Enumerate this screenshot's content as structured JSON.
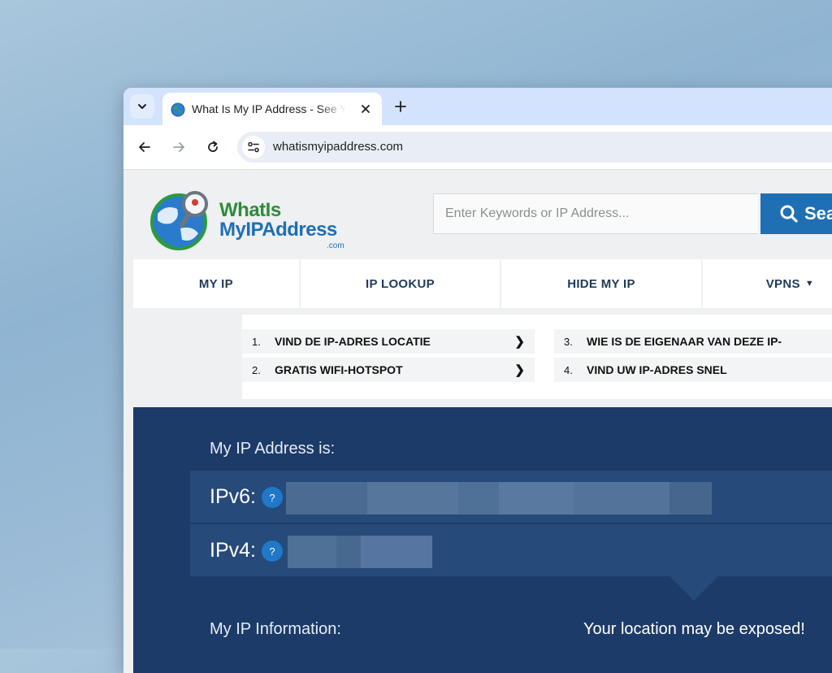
{
  "browser": {
    "tab": {
      "title": "What Is My IP Address - See Your Public IP",
      "favicon": "globe-icon"
    },
    "url": "whatismyipaddress.com"
  },
  "site": {
    "logo": {
      "line1": "WhatIs",
      "line2": "MyIPAddress",
      "line3": ".com"
    },
    "search": {
      "placeholder": "Enter Keywords or IP Address...",
      "button_label": "Sea"
    },
    "nav": [
      {
        "label": "MY IP"
      },
      {
        "label": "IP LOOKUP"
      },
      {
        "label": "HIDE MY IP"
      },
      {
        "label": "VPNS",
        "caret": "▼"
      }
    ],
    "ads": [
      {
        "num": "1.",
        "label": "VIND DE IP-ADRES LOCATIE",
        "chevron": "❯"
      },
      {
        "num": "2.",
        "label": "GRATIS WIFI-HOTSPOT",
        "chevron": "❯"
      },
      {
        "num": "3.",
        "label": "WIE IS DE EIGENAAR VAN DEZE IP-",
        "chevron": "❯"
      },
      {
        "num": "4.",
        "label": "VIND UW IP-ADRES SNEL",
        "chevron": "❯"
      }
    ],
    "hero": {
      "title": "My IP Address is:",
      "ipv6_label": "IPv6:",
      "ipv4_label": "IPv4:",
      "help": "?",
      "info_label": "My IP Information:",
      "warning": "Your location may be exposed!"
    }
  },
  "colors": {
    "brand_blue": "#1f6fb5",
    "hero_bg": "#1d3b68",
    "row_bg": "#264a79"
  }
}
